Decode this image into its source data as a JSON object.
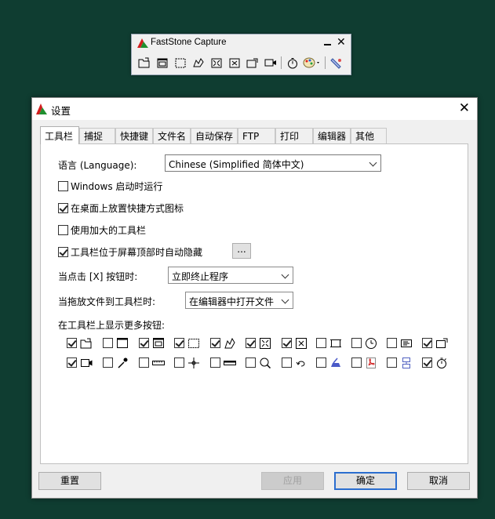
{
  "toolbar": {
    "title": "FastStone Capture",
    "buttons": [
      "open-icon",
      "capture-window-icon",
      "capture-rectangle-icon",
      "capture-freehand-icon",
      "capture-fullscreen-icon",
      "capture-scrolling-icon",
      "capture-fixed-region-icon",
      "screen-recorder-icon",
      "timer-icon",
      "output-color-icon",
      "settings-icon"
    ]
  },
  "dialog": {
    "title": "设置",
    "tabs": [
      "工具栏",
      "捕捉",
      "快捷键",
      "文件名",
      "自动保存",
      "FTP",
      "打印",
      "编辑器",
      "其他"
    ],
    "language_label": "语言 (Language):",
    "language_value": "Chinese (Simplified 简体中文)",
    "opt_startup": "Windows 启动时运行",
    "opt_desktop": "在桌面上放置快捷方式图标",
    "opt_large": "使用加大的工具栏",
    "opt_autohide": "工具栏位于屏幕顶部时自动隐藏",
    "dots": "...",
    "close_label": "当点击 [X] 按钮时:",
    "close_value": "立即终止程序",
    "drag_label": "当拖放文件到工具栏时:",
    "drag_value": "在编辑器中打开文件",
    "more_label": "在工具栏上显示更多按钮:",
    "btn_reset": "重置",
    "btn_apply": "应用",
    "btn_ok": "确定",
    "btn_cancel": "取消"
  },
  "more_buttons": [
    {
      "icon": "open-icon",
      "checked": true
    },
    {
      "icon": "capture-window-icon",
      "checked": false
    },
    {
      "icon": "capture-object-icon",
      "checked": true
    },
    {
      "icon": "capture-rectangle-icon",
      "checked": true
    },
    {
      "icon": "capture-freehand-icon",
      "checked": true
    },
    {
      "icon": "capture-fullscreen-icon",
      "checked": true
    },
    {
      "icon": "capture-scrolling-icon",
      "checked": true
    },
    {
      "icon": "capture-fixed-region-icon",
      "checked": false
    },
    {
      "icon": "delayed-capture-icon",
      "checked": false
    },
    {
      "icon": "ocr-icon",
      "checked": false
    },
    {
      "icon": "capture-region-icon",
      "checked": true
    },
    {
      "icon": "screen-recorder-icon",
      "checked": true
    },
    {
      "icon": "color-picker-icon",
      "checked": false
    },
    {
      "icon": "ruler-icon",
      "checked": false
    },
    {
      "icon": "crosshair-icon",
      "checked": false
    },
    {
      "icon": "screen-pen-icon",
      "checked": false
    },
    {
      "icon": "magnifier-icon",
      "checked": false
    },
    {
      "icon": "undo-icon",
      "checked": false
    },
    {
      "icon": "scanner-icon",
      "checked": false
    },
    {
      "icon": "pdf-icon",
      "checked": false
    },
    {
      "icon": "combine-images-icon",
      "checked": false
    },
    {
      "icon": "timer-icon",
      "checked": true
    }
  ]
}
